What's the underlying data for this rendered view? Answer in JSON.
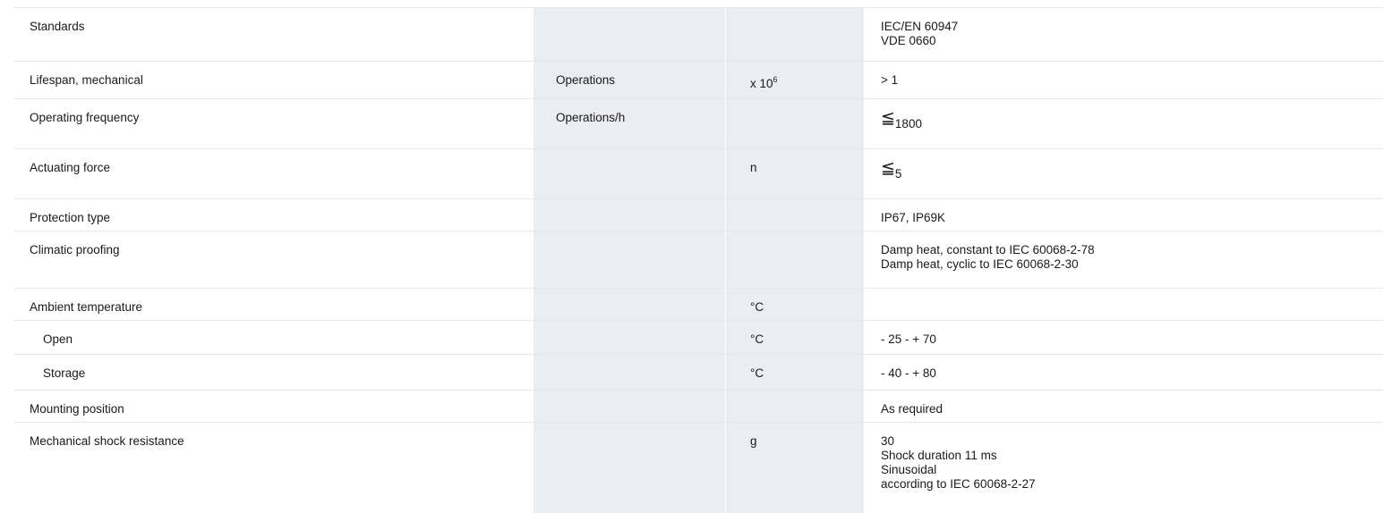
{
  "rows": [
    {
      "name": "Standards",
      "quantity": "",
      "unit": "",
      "value_lines": [
        "IEC/EN 60947",
        "VDE 0660"
      ]
    },
    {
      "name": "Lifespan, mechanical",
      "quantity": "Operations",
      "unit_base": "x 10",
      "unit_exp": "6",
      "value_lines": [
        "> 1"
      ]
    },
    {
      "name": "Operating frequency",
      "quantity": "Operations/h",
      "unit": "",
      "value_symbol": "≦",
      "value_sub": "1800"
    },
    {
      "name": "Actuating force",
      "quantity": "",
      "unit": "n",
      "value_symbol": "≦",
      "value_sub": "5"
    },
    {
      "name": "Protection type",
      "quantity": "",
      "unit": "",
      "value_lines": [
        "IP67, IP69K"
      ]
    },
    {
      "name": "Climatic proofing",
      "quantity": "",
      "unit": "",
      "value_lines": [
        "Damp heat, constant to IEC 60068-2-78",
        "Damp heat, cyclic to IEC 60068-2-30"
      ]
    },
    {
      "name": "Ambient temperature",
      "quantity": "",
      "unit": "°C",
      "value_lines": []
    },
    {
      "name": "Open",
      "quantity": "",
      "unit": "°C",
      "value_lines": [
        "- 25 - + 70"
      ]
    },
    {
      "name": "Storage",
      "quantity": "",
      "unit": "°C",
      "value_lines": [
        "- 40 - + 80"
      ]
    },
    {
      "name": "Mounting position",
      "quantity": "",
      "unit": "",
      "value_lines": [
        "As required"
      ]
    },
    {
      "name": "Mechanical shock resistance",
      "quantity": "",
      "unit": "g",
      "value_lines": [
        "30",
        "Shock duration 11 ms",
        "Sinusoidal",
        "according to IEC 60068-2-27"
      ]
    }
  ]
}
